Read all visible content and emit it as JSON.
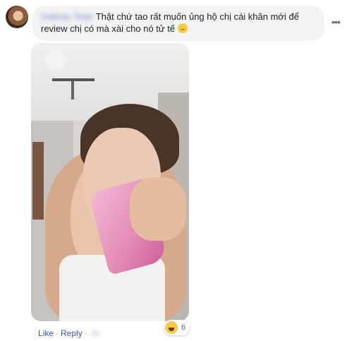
{
  "comment": {
    "author": "Celeny Tran",
    "text": "Thật chứ tao rất muốn ủng hộ chị cái khăn mới để review chị có mà xài cho nó tử tế",
    "text_emoji": "crying-face-icon"
  },
  "actions": {
    "like_label": "Like",
    "separator": "·",
    "reply_label": "Reply",
    "time": "1h",
    "reaction_emoji": "laughing-face-icon",
    "reaction_count": "6"
  },
  "icons": {
    "more": "more-horizontal-icon",
    "avatar": "avatar"
  },
  "colors": {
    "link": "#385898",
    "bubble": "#f2f3f5",
    "text": "#1c1e21",
    "muted": "#90949c"
  }
}
